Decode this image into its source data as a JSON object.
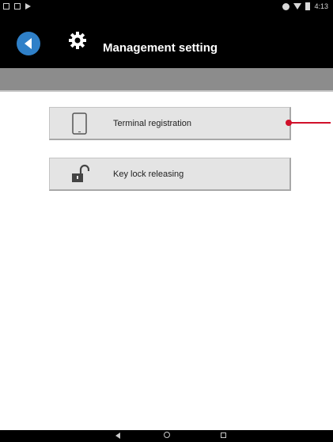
{
  "status_bar": {
    "time": "4:13",
    "icons": [
      "image-icon",
      "sd-card-icon",
      "play-icon",
      "alarm-icon",
      "wifi-icon",
      "battery-icon"
    ]
  },
  "app_bar": {
    "title": "Management setting",
    "back_icon": "back-arrow-icon",
    "settings_icon": "gear-icon",
    "accent_color": "#2f80c8"
  },
  "menu": {
    "items": [
      {
        "label": "Terminal registration",
        "icon": "tablet-icon"
      },
      {
        "label": "Key lock releasing",
        "icon": "unlock-icon"
      }
    ]
  },
  "annotation": {
    "color": "#d0102a"
  },
  "nav_bar": {
    "buttons": [
      "back-icon",
      "home-icon",
      "recent-apps-icon"
    ]
  }
}
